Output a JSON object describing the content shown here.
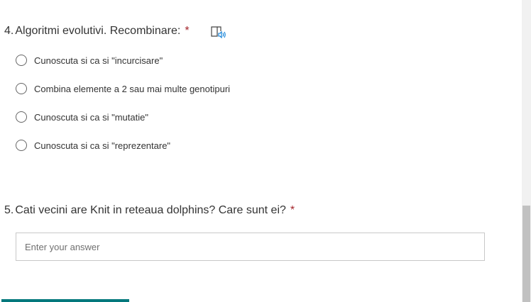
{
  "questions": [
    {
      "number": "4.",
      "title": "Algoritmi evolutivi. Recombinare:",
      "required_mark": "*",
      "icon": "immersive-reader-icon",
      "options": [
        "Cunoscuta si ca si \"incurcisare\"",
        "Combina elemente a 2 sau mai multe genotipuri",
        "Cunoscuta si ca si \"mutatie\"",
        "Cunoscuta si ca si \"reprezentare\""
      ]
    },
    {
      "number": "5.",
      "title": "Cati vecini are Knit in reteaua dolphins? Care sunt ei?",
      "required_mark": "*",
      "input_placeholder": "Enter your answer",
      "input_value": ""
    }
  ],
  "colors": {
    "required": "#a4262c",
    "accent": "#03787c",
    "icon_accent": "#0078d4"
  }
}
